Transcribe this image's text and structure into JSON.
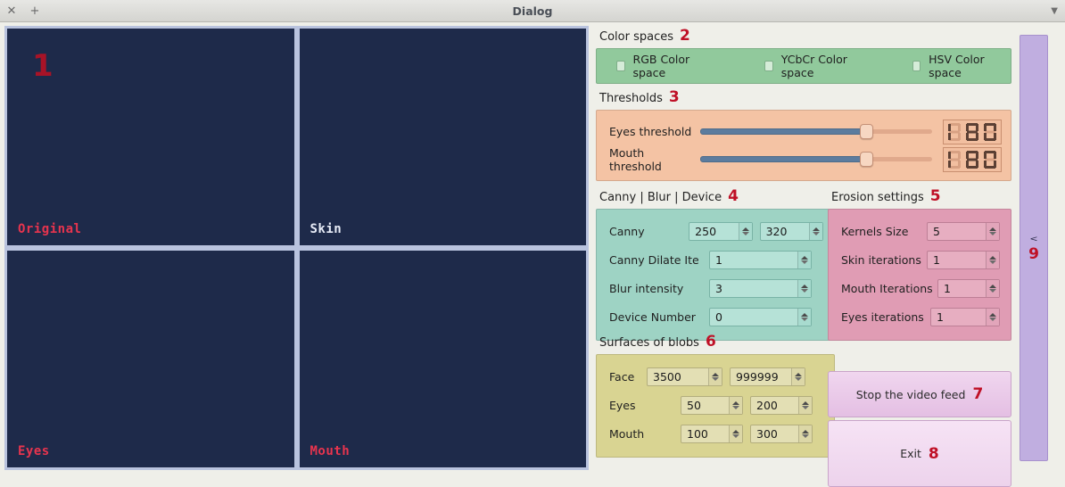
{
  "window": {
    "title": "Dialog",
    "close_icon": "close-icon",
    "add_icon": "plus-icon",
    "menu_icon": "chevron-down-icon"
  },
  "video_panels": [
    {
      "label": "Original",
      "marker": "1",
      "label_color": "#e8344e"
    },
    {
      "label": "Skin",
      "marker": "",
      "label_color": "#e8ecf7"
    },
    {
      "label": "Eyes",
      "marker": "",
      "label_color": "#e8344e"
    },
    {
      "label": "Mouth",
      "marker": "",
      "label_color": "#e8344e"
    }
  ],
  "color_spaces": {
    "title": "Color spaces",
    "marker": "2",
    "options": [
      {
        "label": "RGB Color space",
        "checked": false
      },
      {
        "label": "YCbCr Color space",
        "checked": false
      },
      {
        "label": "HSV Color space",
        "checked": false
      }
    ]
  },
  "thresholds": {
    "title": "Thresholds",
    "marker": "3",
    "rows": [
      {
        "label": "Eyes threshold",
        "value": "180",
        "percent": 70
      },
      {
        "label": "Mouth threshold",
        "value": "180",
        "percent": 70
      }
    ]
  },
  "canny": {
    "title": "Canny | Blur | Device",
    "marker": "4",
    "rows": [
      {
        "label": "Canny",
        "value": "250",
        "value2": "320"
      },
      {
        "label": "Canny Dilate Ite",
        "value": "1"
      },
      {
        "label": "Blur intensity",
        "value": "3"
      },
      {
        "label": "Device Number",
        "value": "0"
      }
    ]
  },
  "erosion": {
    "title": "Erosion settings",
    "marker": "5",
    "rows": [
      {
        "label": "Kernels Size",
        "value": "5"
      },
      {
        "label": "Skin iterations",
        "value": "1"
      },
      {
        "label": "Mouth Iterations",
        "value": "1"
      },
      {
        "label": "Eyes iterations",
        "value": "1"
      }
    ]
  },
  "blobs": {
    "title": "Surfaces of blobs",
    "marker": "6",
    "rows": [
      {
        "label": "Face",
        "value": "3500",
        "value2": "999999"
      },
      {
        "label": "Eyes",
        "value": "50",
        "value2": "200"
      },
      {
        "label": "Mouth",
        "value": "100",
        "value2": "300"
      }
    ]
  },
  "buttons": {
    "stop": {
      "label": "Stop the video feed",
      "marker": "7"
    },
    "exit": {
      "label": "Exit",
      "marker": "8"
    }
  },
  "splitter": {
    "glyph": "<",
    "marker": "9"
  },
  "colors": {
    "marker_red": "#bf1026",
    "colorspace_panel": "#91c99c",
    "threshold_panel": "#f4c3a4",
    "canny_panel": "#9ed3c4",
    "erosion_panel": "#e09cb4",
    "blobs_panel": "#d9d492",
    "button_panel": "#edd3ec",
    "splitter_panel": "#c0aee0",
    "video_bg": "#1e2a4a"
  }
}
